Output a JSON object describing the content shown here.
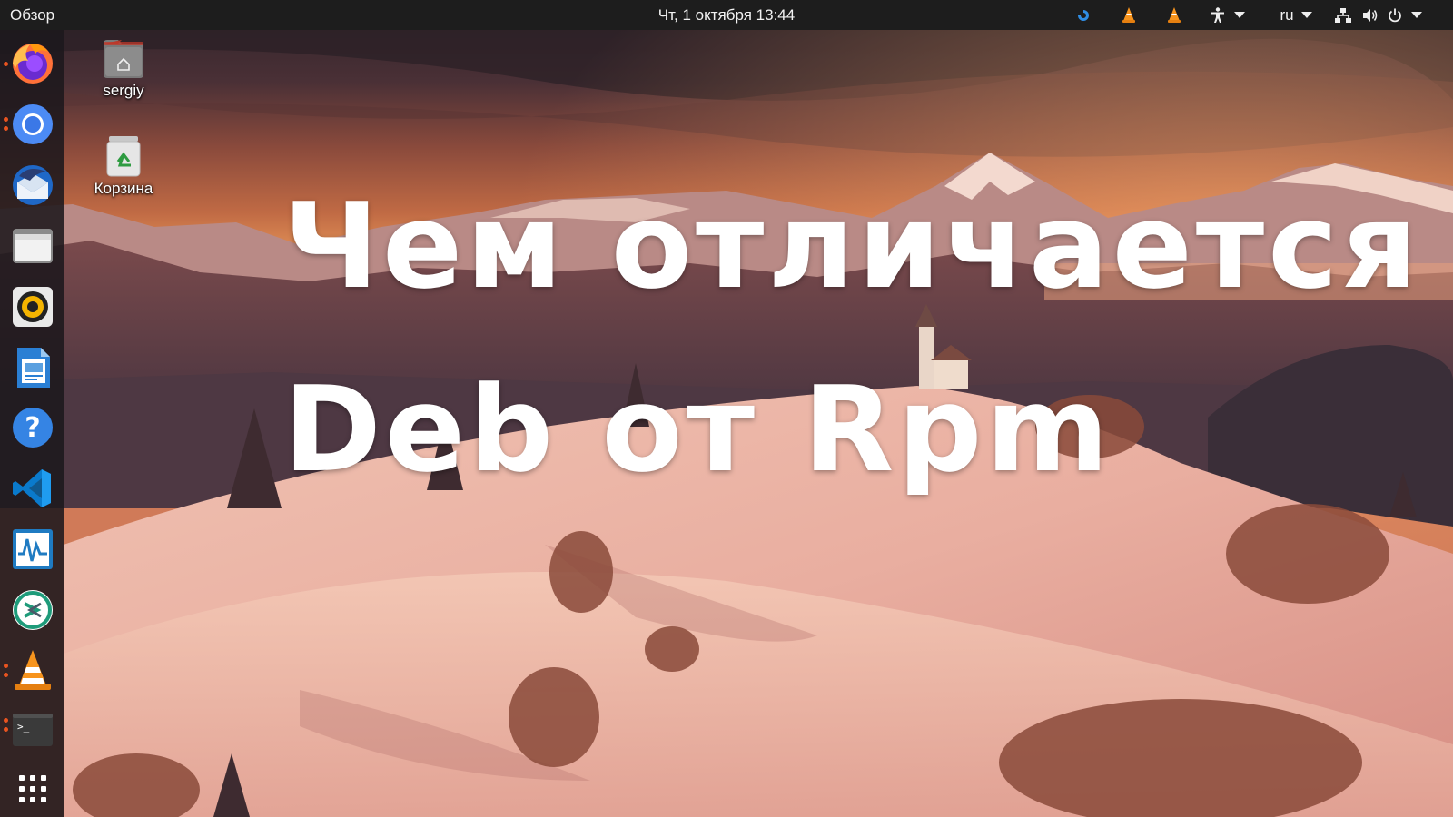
{
  "topbar": {
    "activities_label": "Обзор",
    "clock": "Чт, 1 октября  13:44",
    "language": "ru",
    "tray_icons": [
      "blue-swirl-icon",
      "vlc-cone-icon",
      "vlc-cone-icon",
      "accessibility-icon",
      "network-icon",
      "volume-icon",
      "power-icon"
    ]
  },
  "dock": {
    "items": [
      {
        "name": "firefox",
        "running": true
      },
      {
        "name": "chromium",
        "running": true
      },
      {
        "name": "thunderbird",
        "running": false
      },
      {
        "name": "files",
        "running": false
      },
      {
        "name": "rhythmbox",
        "running": false
      },
      {
        "name": "libreoffice-writer",
        "running": false
      },
      {
        "name": "help",
        "running": false
      },
      {
        "name": "vscode",
        "running": false
      },
      {
        "name": "system-monitor",
        "running": false
      },
      {
        "name": "remote-desktop",
        "running": false
      },
      {
        "name": "vlc",
        "running": true
      },
      {
        "name": "terminal",
        "running": true
      },
      {
        "name": "show-applications",
        "running": false
      }
    ]
  },
  "desktop": {
    "icons": [
      {
        "label": "sergiy",
        "icon": "home-folder-icon"
      },
      {
        "label": "Корзина",
        "icon": "trash-icon"
      }
    ]
  },
  "headline": {
    "line1": "Чем отличается",
    "line2": "Deb от Rpm"
  },
  "colors": {
    "topbar": "#1d1d1d",
    "accent": "#e95420",
    "title_text": "#ffffff"
  }
}
